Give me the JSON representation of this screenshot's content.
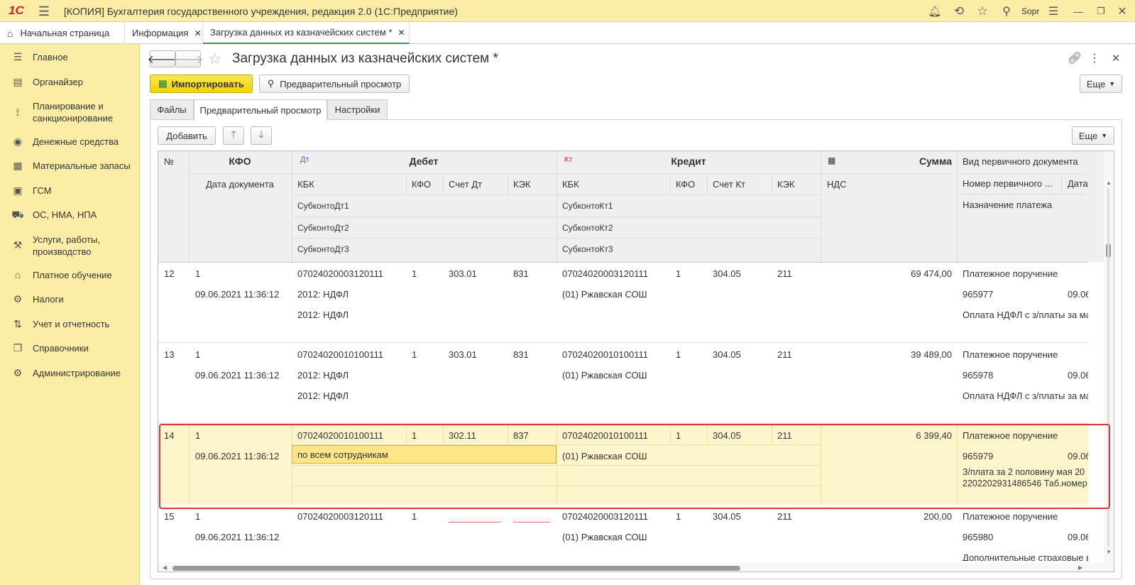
{
  "app": {
    "logo": "1С",
    "title": "[КОПИЯ] Бухгалтерия государственного учреждения, редакция 2.0  (1С:Предприятие)",
    "user": "Sopr"
  },
  "tabs": [
    {
      "label": "Начальная страница"
    },
    {
      "label": "Информация"
    },
    {
      "label": "Загрузка данных из казначейских систем *"
    }
  ],
  "sidebar": {
    "items": [
      {
        "label": "Главное",
        "icon": "menu-icon"
      },
      {
        "label": "Органайзер",
        "icon": "notes-icon"
      },
      {
        "label": "Планирование и санкционирование",
        "icon": "chart-icon"
      },
      {
        "label": "Денежные средства",
        "icon": "coin-icon"
      },
      {
        "label": "Материальные запасы",
        "icon": "grid-icon"
      },
      {
        "label": "ГСМ",
        "icon": "fuel-icon"
      },
      {
        "label": "ОС, НМА, НПА",
        "icon": "truck-icon"
      },
      {
        "label": "Услуги, работы, производство",
        "icon": "tools-icon"
      },
      {
        "label": "Платное обучение",
        "icon": "cap-icon"
      },
      {
        "label": "Налоги",
        "icon": "tax-icon"
      },
      {
        "label": "Учет и отчетность",
        "icon": "report-icon"
      },
      {
        "label": "Справочники",
        "icon": "book-icon"
      },
      {
        "label": "Администрирование",
        "icon": "gear-icon"
      }
    ]
  },
  "form": {
    "title": "Загрузка данных из казначейских систем *",
    "import_label": "Импортировать",
    "preview_label": "Предварительный просмотр",
    "more_label": "Еще",
    "tabs": [
      {
        "label": "Файлы"
      },
      {
        "label": "Предварительный просмотр"
      },
      {
        "label": "Настройки"
      }
    ],
    "add_label": "Добавить",
    "table_more_label": "Еще"
  },
  "table": {
    "headers": {
      "num": "№",
      "kfo": "КФО",
      "doc_date": "Дата документа",
      "dt_mark": "Дт",
      "debet": "Дебет",
      "kt_mark": "Кт",
      "kredit": "Кредит",
      "summa": "Сумма",
      "doc_type": "Вид первичного документа",
      "kbk_dt": "КБК",
      "kfo_dt": "КФО",
      "schet_dt": "Счет Дт",
      "kek_dt": "КЭК",
      "kbk_kt": "КБК",
      "kfo_kt": "КФО",
      "schet_kt": "Счет Кт",
      "kek_kt": "КЭК",
      "nds": "НДС",
      "doc_num": "Номер первичного ...",
      "doc_date2": "Дата",
      "sub_dt1": "СубконтоДт1",
      "sub_dt2": "СубконтоДт2",
      "sub_dt3": "СубконтоДт3",
      "sub_kt1": "СубконтоКт1",
      "sub_kt2": "СубконтоКт2",
      "sub_kt3": "СубконтоКт3",
      "purpose": "Назначение платежа"
    },
    "rows": [
      {
        "num": "12",
        "kfo": "1",
        "date": "09.06.2021 11:36:12",
        "kbk_dt": "07024020003120111",
        "kfo_dt": "1",
        "schet_dt": "303.01",
        "kek_dt": "831",
        "sub_dt1": "2012: НДФЛ",
        "sub_dt2": "2012: НДФЛ",
        "kbk_kt": "07024020003120111",
        "kfo_kt": "1",
        "schet_kt": "304.05",
        "kek_kt": "211",
        "sub_kt1": "(01) Ржавская СОШ",
        "summa": "69 474,00",
        "doc_type": "Платежное поручение",
        "doc_num": "965977",
        "doc_date": "09.06",
        "purpose": "Оплата НДФЛ с з/платы за ма",
        "purpose2": ""
      },
      {
        "num": "13",
        "kfo": "1",
        "date": "09.06.2021 11:36:12",
        "kbk_dt": "07024020010100111",
        "kfo_dt": "1",
        "schet_dt": "303.01",
        "kek_dt": "831",
        "sub_dt1": "2012: НДФЛ",
        "sub_dt2": "2012: НДФЛ",
        "kbk_kt": "07024020010100111",
        "kfo_kt": "1",
        "schet_kt": "304.05",
        "kek_kt": "211",
        "sub_kt1": "(01) Ржавская СОШ",
        "summa": "39 489,00",
        "doc_type": "Платежное поручение",
        "doc_num": "965978",
        "doc_date": "09.06",
        "purpose": "Оплата НДФЛ с з/платы за ма",
        "purpose2": ""
      },
      {
        "num": "14",
        "kfo": "1",
        "date": "09.06.2021 11:36:12",
        "kbk_dt": "07024020010100111",
        "kfo_dt": "1",
        "schet_dt": "302.11",
        "kek_dt": "837",
        "sub_dt1": "по всем сотрудникам",
        "sub_dt2": "",
        "kbk_kt": "07024020010100111",
        "kfo_kt": "1",
        "schet_kt": "304.05",
        "kek_kt": "211",
        "sub_kt1": "(01) Ржавская СОШ",
        "summa": "6 399,40",
        "doc_type": "Платежное поручение",
        "doc_num": "965979",
        "doc_date": "09.06",
        "purpose": "З/плата за 2 половину мая 20",
        "purpose2": "2202202931486546 Таб.номер"
      },
      {
        "num": "15",
        "kfo": "1",
        "date": "09.06.2021 11:36:12",
        "kbk_dt": "07024020003120111",
        "kfo_dt": "1",
        "schet_dt": "",
        "kek_dt": "",
        "sub_dt1": "",
        "sub_dt2": "",
        "kbk_kt": "07024020003120111",
        "kfo_kt": "1",
        "schet_kt": "304.05",
        "kek_kt": "211",
        "sub_kt1": "(01) Ржавская СОШ",
        "summa": "200,00",
        "doc_type": "Платежное поручение",
        "doc_num": "965980",
        "doc_date": "09.06",
        "purpose": "Дополнительные страховые в",
        "purpose2": ""
      }
    ]
  },
  "colors": {
    "accent_yellow": "#fbeda6",
    "selected_row": "#fff5cc",
    "highlight_red": "#d9363e",
    "active_cell": "#fde58a",
    "dt_label": "#3a6fc9",
    "kt_label": "#d33"
  }
}
